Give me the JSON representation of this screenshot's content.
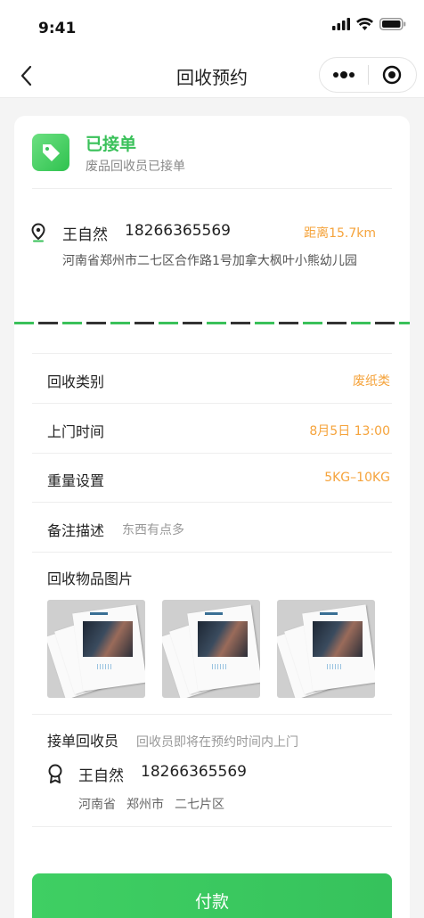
{
  "status_bar": {
    "time": "9:41"
  },
  "nav": {
    "title": "回收预约"
  },
  "order": {
    "status_title": "已接单",
    "status_subtitle": "废品回收员已接单"
  },
  "contact": {
    "name": "王自然",
    "phone": "18266365569",
    "distance": "距离15.7km",
    "address": "河南省郑州市二七区合作路1号加拿大枫叶小熊幼儿园"
  },
  "details": [
    {
      "label": "回收类别",
      "value": "废纸类"
    },
    {
      "label": "上门时间",
      "value": "8月5日  13:00"
    },
    {
      "label": "重量设置",
      "value": "5KG–10KG"
    }
  ],
  "remark": {
    "label": "备注描述",
    "value": "东西有点多"
  },
  "photos": {
    "title": "回收物品图片",
    "count": 3
  },
  "collector": {
    "label": "接单回收员",
    "note": "回收员即将在预约时间内上门",
    "name": "王自然",
    "phone": "18266365569",
    "province": "河南省",
    "city": "郑州市",
    "district": "二七片区"
  },
  "pay_button": {
    "label": "付款"
  },
  "colors": {
    "accent_green": "#3ac15a",
    "accent_orange": "#f5a33b"
  },
  "icons": [
    "back-icon",
    "more-icon",
    "target-icon",
    "tag-icon",
    "location-pin-icon",
    "collector-badge-icon"
  ]
}
